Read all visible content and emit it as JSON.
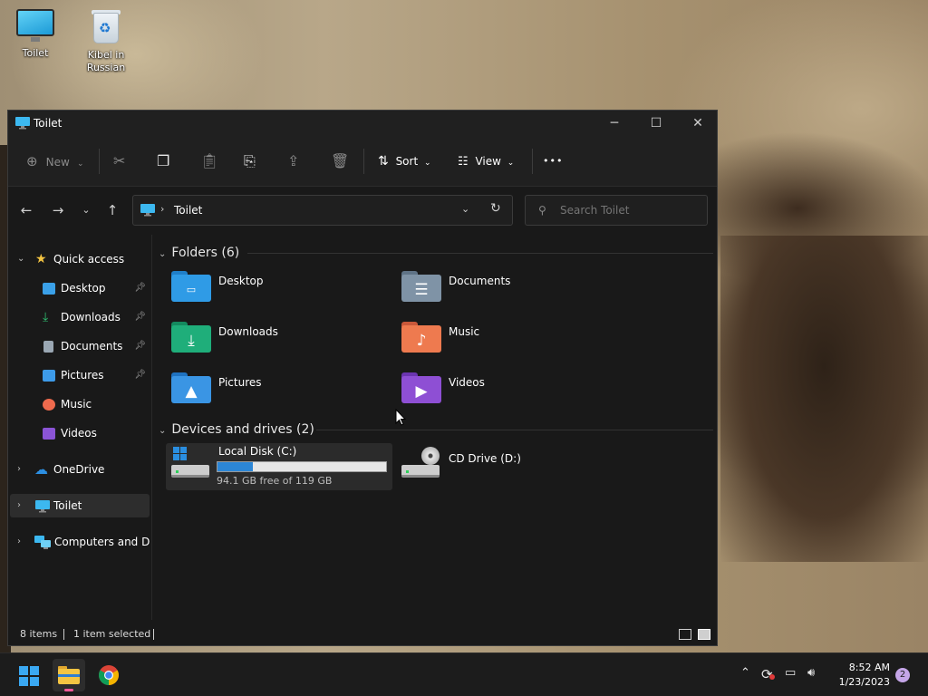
{
  "desktop": {
    "icons": [
      {
        "label": "Toilet",
        "icon": "computer-icon"
      },
      {
        "label": "Kibel in Russian",
        "icon": "recycle-bin-icon"
      }
    ]
  },
  "window": {
    "title": "Toilet",
    "controls": {
      "minimize": "─",
      "maximize": "☐",
      "close": "✕"
    }
  },
  "toolbar": {
    "new_label": "New",
    "sort_label": "Sort",
    "view_label": "View",
    "more_label": "•••"
  },
  "address": {
    "path": "Toilet",
    "search_placeholder": "Search Toilet"
  },
  "sidebar": {
    "quick_access": "Quick access",
    "items": [
      {
        "label": "Desktop",
        "pinned": true,
        "color": "#3aa0e8"
      },
      {
        "label": "Downloads",
        "pinned": true,
        "color": "#2fbf71"
      },
      {
        "label": "Documents",
        "pinned": true,
        "color": "#9aa7b3"
      },
      {
        "label": "Pictures",
        "pinned": true,
        "color": "#3d9be9"
      },
      {
        "label": "Music",
        "pinned": false,
        "color": "#ef6a4d"
      },
      {
        "label": "Videos",
        "pinned": false,
        "color": "#8b54d6"
      }
    ],
    "onedrive": "OneDrive",
    "this_pc": "Toilet",
    "network": "Computers and Devices"
  },
  "content": {
    "folders_header": "Folders (6)",
    "folders": [
      {
        "label": "Desktop",
        "color": "#2f9be6",
        "icon": "desktop-folder-icon"
      },
      {
        "label": "Documents",
        "color": "#7f93a6",
        "icon": "documents-folder-icon"
      },
      {
        "label": "Downloads",
        "color": "#1fae7a",
        "icon": "downloads-folder-icon"
      },
      {
        "label": "Music",
        "color": "#ee7a4f",
        "icon": "music-folder-icon"
      },
      {
        "label": "Pictures",
        "color": "#3a95e4",
        "icon": "pictures-folder-icon"
      },
      {
        "label": "Videos",
        "color": "#8e4fd4",
        "icon": "videos-folder-icon"
      }
    ],
    "drives_header": "Devices and drives (2)",
    "drives": [
      {
        "label": "Local Disk (C:)",
        "free_text": "94.1 GB free of 119 GB",
        "used_fraction": 0.21
      },
      {
        "label": "CD Drive (D:)"
      }
    ]
  },
  "status": {
    "items_count": "8 items",
    "selected": "1 item selected"
  },
  "taskbar": {
    "time": "8:52 AM",
    "date": "1/23/2023",
    "notifications": "2"
  }
}
